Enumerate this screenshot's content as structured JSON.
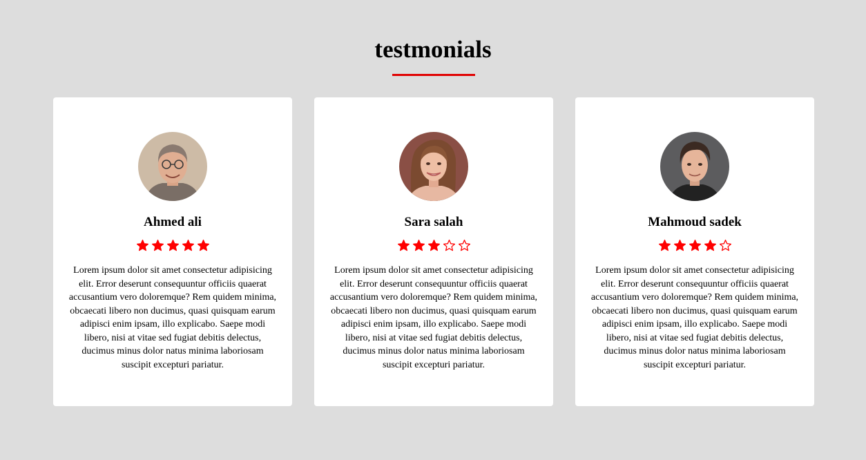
{
  "header": {
    "title": "testmonials",
    "accent_color": "#e00000"
  },
  "testimonials": [
    {
      "name": "Ahmed ali",
      "rating": 5,
      "max_rating": 5,
      "text": "Lorem ipsum dolor sit amet consectetur adipisicing elit. Error deserunt consequuntur officiis quaerat accusantium vero doloremque? Rem quidem minima, obcaecati libero non ducimus, quasi quisquam earum adipisci enim ipsam, illo explicabo. Saepe modi libero, nisi at vitae sed fugiat debitis delectus, ducimus minus dolor natus minima laboriosam suscipit excepturi pariatur."
    },
    {
      "name": "Sara salah",
      "rating": 3,
      "max_rating": 5,
      "text": "Lorem ipsum dolor sit amet consectetur adipisicing elit. Error deserunt consequuntur officiis quaerat accusantium vero doloremque? Rem quidem minima, obcaecati libero non ducimus, quasi quisquam earum adipisci enim ipsam, illo explicabo. Saepe modi libero, nisi at vitae sed fugiat debitis delectus, ducimus minus dolor natus minima laboriosam suscipit excepturi pariatur."
    },
    {
      "name": "Mahmoud sadek",
      "rating": 4,
      "max_rating": 5,
      "text": "Lorem ipsum dolor sit amet consectetur adipisicing elit. Error deserunt consequuntur officiis quaerat accusantium vero doloremque? Rem quidem minima, obcaecati libero non ducimus, quasi quisquam earum adipisci enim ipsam, illo explicabo. Saepe modi libero, nisi at vitae sed fugiat debitis delectus, ducimus minus dolor natus minima laboriosam suscipit excepturi pariatur."
    }
  ],
  "colors": {
    "background": "#dddddd",
    "card": "#ffffff",
    "star": "#ff0000"
  }
}
